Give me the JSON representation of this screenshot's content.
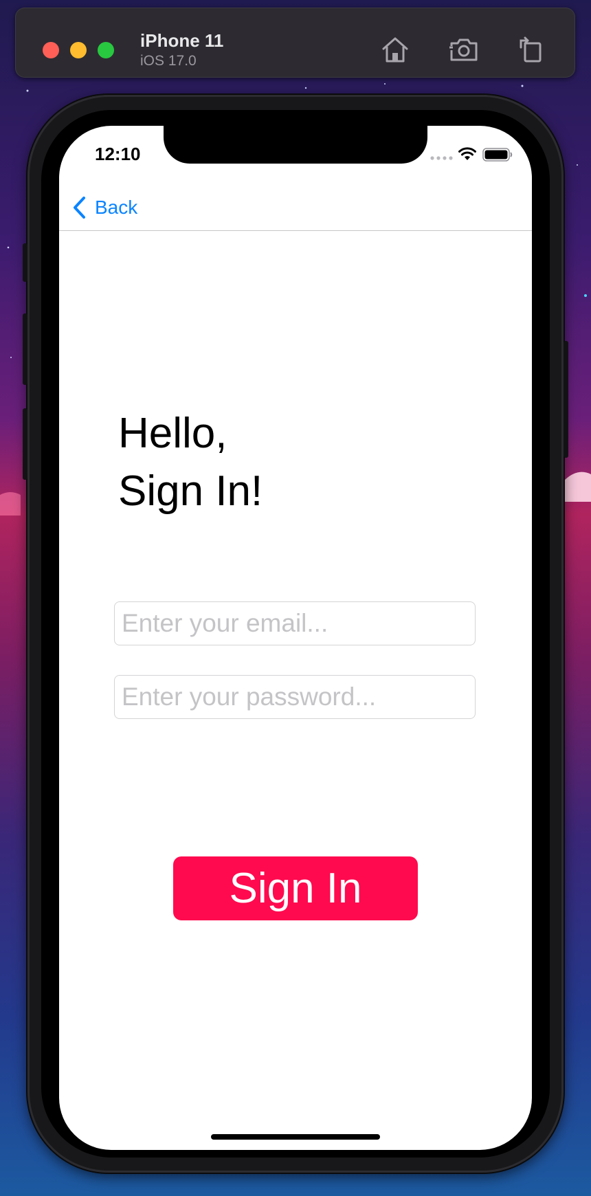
{
  "simulator": {
    "device_name": "iPhone 11",
    "os_version": "iOS 17.0",
    "toolbar_icons": [
      "home-icon",
      "screenshot-icon",
      "rotate-icon"
    ]
  },
  "status_bar": {
    "time": "12:10",
    "icons": [
      "cellular-signal-icon",
      "wifi-icon",
      "battery-icon"
    ]
  },
  "nav": {
    "back_label": "Back",
    "back_icon": "chevron-left-icon"
  },
  "greeting": {
    "line1": "Hello,",
    "line2": "Sign In!"
  },
  "form": {
    "email_placeholder": "Enter your email...",
    "email_value": "",
    "password_placeholder": "Enter your password...",
    "password_value": ""
  },
  "sign_in_button": {
    "label": "Sign In"
  },
  "colors": {
    "accent_blue": "#0a84ff",
    "button_red": "#ff0a4f",
    "placeholder_gray": "#c4c4c7"
  }
}
